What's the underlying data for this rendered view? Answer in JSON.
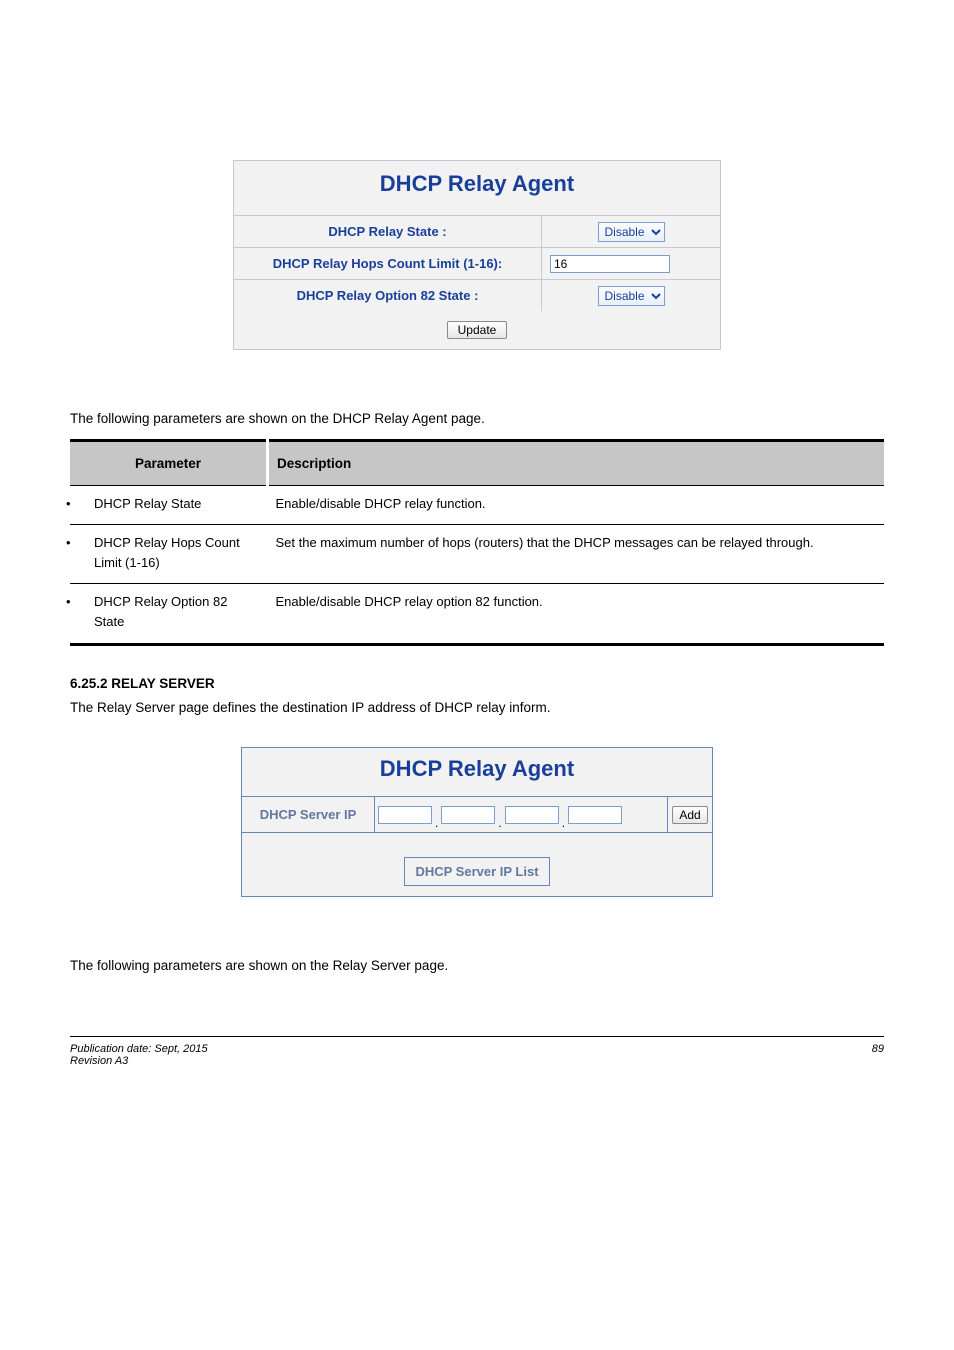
{
  "screenshot1": {
    "title": "DHCP Relay Agent",
    "rows": [
      {
        "label": "DHCP Relay State :",
        "select_value": "Disable"
      },
      {
        "label": "DHCP Relay Hops Count Limit (1-16):",
        "text_value": "16"
      },
      {
        "label": "DHCP Relay Option 82 State :",
        "select_value": "Disable"
      }
    ],
    "update_button": "Update"
  },
  "caption1": "The following parameters are shown on the DHCP Relay Agent page.",
  "def_table": {
    "head_param": "Parameter",
    "head_desc": "Description",
    "rows": [
      {
        "param": "DHCP Relay State",
        "desc": "Enable/disable DHCP relay function."
      },
      {
        "param": "DHCP Relay Hops Count Limit (1-16)",
        "desc": "Set the maximum number of hops (routers) that the DHCP messages can be relayed through."
      },
      {
        "param": "DHCP Relay Option 82 State",
        "desc": "Enable/disable DHCP relay option 82 function."
      }
    ]
  },
  "subsection_num": "6.25.2 RELAY SERVER",
  "subsection_desc": "The Relay Server page defines the destination IP address of DHCP relay inform.",
  "screenshot2": {
    "title": "DHCP Relay Agent",
    "ip_label": "DHCP Server IP",
    "add_button": "Add",
    "list_title": "DHCP Server IP List"
  },
  "caption2": "The following parameters are shown on the Relay Server page.",
  "footer": {
    "left": "Publication date: Sept, 2015",
    "right": "89",
    "rev": "Revision A3"
  }
}
